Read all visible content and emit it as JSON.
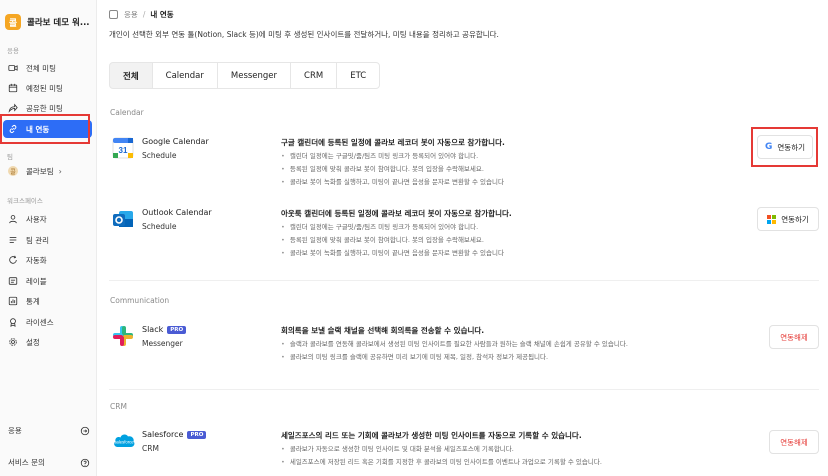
{
  "sidebar": {
    "brand_letter": "콜",
    "brand_name": "콜라보 데모 워...",
    "section_app": "응용",
    "section_team": "팀",
    "section_workspace": "워크스페이스",
    "items": [
      {
        "label": "전체 미팅",
        "icon": "video-icon"
      },
      {
        "label": "예정된 미팅",
        "icon": "calendar-icon"
      },
      {
        "label": "공유한 미팅",
        "icon": "share-icon"
      },
      {
        "label": "내 연동",
        "icon": "link-icon",
        "active": true
      }
    ],
    "team": {
      "dot": "콜",
      "label": "콜라보팀",
      "chevron": "›"
    },
    "workspace_items": [
      {
        "label": "사용자",
        "icon": "user-icon"
      },
      {
        "label": "팀 관리",
        "icon": "team-icon"
      },
      {
        "label": "자동화",
        "icon": "automation-icon"
      },
      {
        "label": "레이블",
        "icon": "label-icon"
      },
      {
        "label": "통계",
        "icon": "chart-icon"
      },
      {
        "label": "라이센스",
        "icon": "license-icon"
      },
      {
        "label": "설정",
        "icon": "gear-icon"
      }
    ],
    "bottom": {
      "apps": "응용",
      "support": "서비스 문의"
    },
    "accent": "#2d6df6"
  },
  "header": {
    "breadcrumb_root": "응용",
    "breadcrumb_sep": "/",
    "breadcrumb_current": "내 연동",
    "description": "개인이 선택한 외부 연동 툴(Notion, Slack 등)에 미팅 후 생성된 인사이트를 전달하거나, 미팅 내용을 정리하고 공유합니다."
  },
  "tabs": [
    "전체",
    "Calendar",
    "Messenger",
    "CRM",
    "ETC"
  ],
  "categories": {
    "calendar": "Calendar",
    "communication": "Communication",
    "crm": "CRM"
  },
  "integrations": {
    "google": {
      "name": "Google Calendar",
      "sub": "Schedule",
      "title": "구글 캘린더에 등록된 일정에 콜라보 레코더 봇이 자동으로 참가합니다.",
      "bullets": [
        "캘린더 일정에는 구글밋/줌/팀즈 미팅 링크가 등록되어 있어야 합니다.",
        "등록된 일정에 맞춰 콜라보 봇이 참여합니다. 봇의 입장을 수락해보세요.",
        "콜라보 봇이 녹화를 실행하고, 미팅이 끝나면 음성을 문자로 변환할 수 있습니다"
      ],
      "button": "연동하기",
      "button_icon": "G"
    },
    "outlook": {
      "name": "Outlook Calendar",
      "sub": "Schedule",
      "title": "아웃룩 캘린더에 등록된 일정에 콜라보 레코더 봇이 자동으로 참가합니다.",
      "bullets": [
        "캘린더 일정에는 구글밋/줌/팀즈 미팅 링크가 등록되어 있어야 합니다.",
        "등록된 일정에 맞춰 콜라보 봇이 참여합니다. 봇의 입장을 수락해보세요.",
        "콜라보 봇이 녹화를 실행하고, 미팅이 끝나면 음성을 문자로 변환할 수 있습니다"
      ],
      "button": "연동하기"
    },
    "slack": {
      "name": "Slack",
      "badge": "PRO",
      "sub": "Messenger",
      "title": "회의록을 보낼 슬랙 채널을 선택해 회의록을 전송할 수 있습니다.",
      "bullets": [
        "슬랙과 콜라보를 연동해 콜라보에서 생성된 미팅 인사이트를 필요한 사람들과 원하는 슬랙 채널에 손쉽게 공유할 수 있습니다.",
        "콜라보의 미팅 링크를 슬랙에 공유하면 미리 보기에 미팅 제목, 일정, 참석자 정보가 제공됩니다."
      ],
      "button": "연동해제"
    },
    "salesforce": {
      "name": "Salesforce",
      "badge": "PRO",
      "sub": "CRM",
      "logo_text": "salesforce",
      "title": "세일즈포스의 리드 또는 기회에 콜라보가 생성한 미팅 인사이트를 자동으로 기록할 수 있습니다.",
      "bullets": [
        "콜라보가 자동으로 생성한 미팅 인사이트 및 대화 분석을 세일즈포스에 기록합니다.",
        "세일즈포스에 저장된 리드 혹은 기회를 지정한 후 콜라보의 미팅 인사이트를 이벤트나 과업으로 기록할 수 있습니다."
      ],
      "button": "연동해제"
    }
  },
  "colors": {
    "danger": "#e53935",
    "pro_badge": "#4a5bd4"
  }
}
